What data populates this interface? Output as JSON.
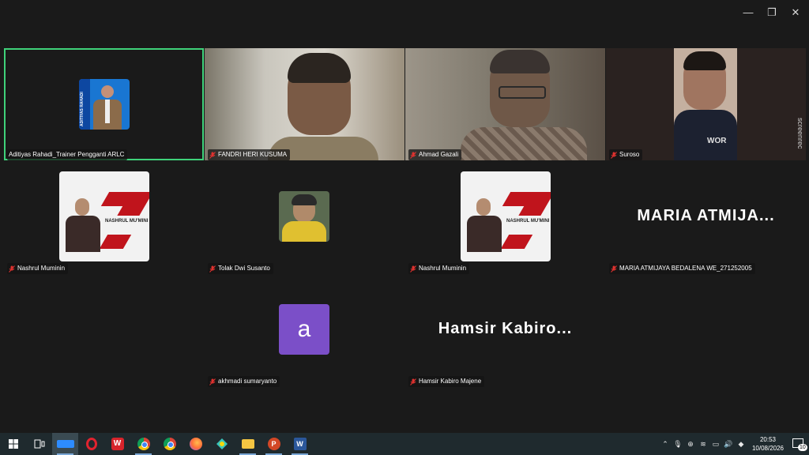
{
  "window_controls": {
    "minimize": "—",
    "restore": "❐",
    "close": "✕"
  },
  "participants": [
    {
      "name": "Aditiyas Rahadi_Trainer Pengganti ARLC",
      "mic_muted": false,
      "active_speaker": true,
      "avatar_caption": "ADITIYAS RAHADI"
    },
    {
      "name": "FANDRI HERI KUSUMA",
      "mic_muted": true
    },
    {
      "name": "Ahmad Gazali",
      "mic_muted": true
    },
    {
      "name": "Suroso",
      "mic_muted": true,
      "watermark": "screenrec"
    },
    {
      "name": "Nashrul Muminin",
      "mic_muted": true,
      "banner_text": "NASHRUL MU'MINI"
    },
    {
      "name": "Tolak Dwi Susanto",
      "mic_muted": true
    },
    {
      "name": "Nashrul Muminin",
      "mic_muted": true,
      "banner_text": "NASHRUL MU'MINI"
    },
    {
      "name": "MARIA ATMIJAYA BEDALENA WE_271252005",
      "mic_muted": true,
      "display_label": "MARIA  ATMIJA..."
    },
    {
      "name": "akhmadi sumaryanto",
      "mic_muted": true,
      "avatar_letter": "a",
      "avatar_color": "#7b4fc8"
    },
    {
      "name": "Hamsir Kabiro Majene",
      "mic_muted": true,
      "display_label": "Hamsir  Kabiro..."
    }
  ],
  "taskbar": {
    "apps": [
      "windows-start",
      "task-view",
      "zoom",
      "opera",
      "wps-office",
      "chrome",
      "chrome-alt",
      "firefox",
      "cap-cut",
      "file-explorer",
      "powerpoint",
      "word"
    ],
    "time": "20:53",
    "date": "10/08/2026",
    "notification_count": "10"
  },
  "colors": {
    "active_border": "#3fd27a",
    "muted_mic": "#e0322f",
    "background": "#1a1a1a"
  }
}
